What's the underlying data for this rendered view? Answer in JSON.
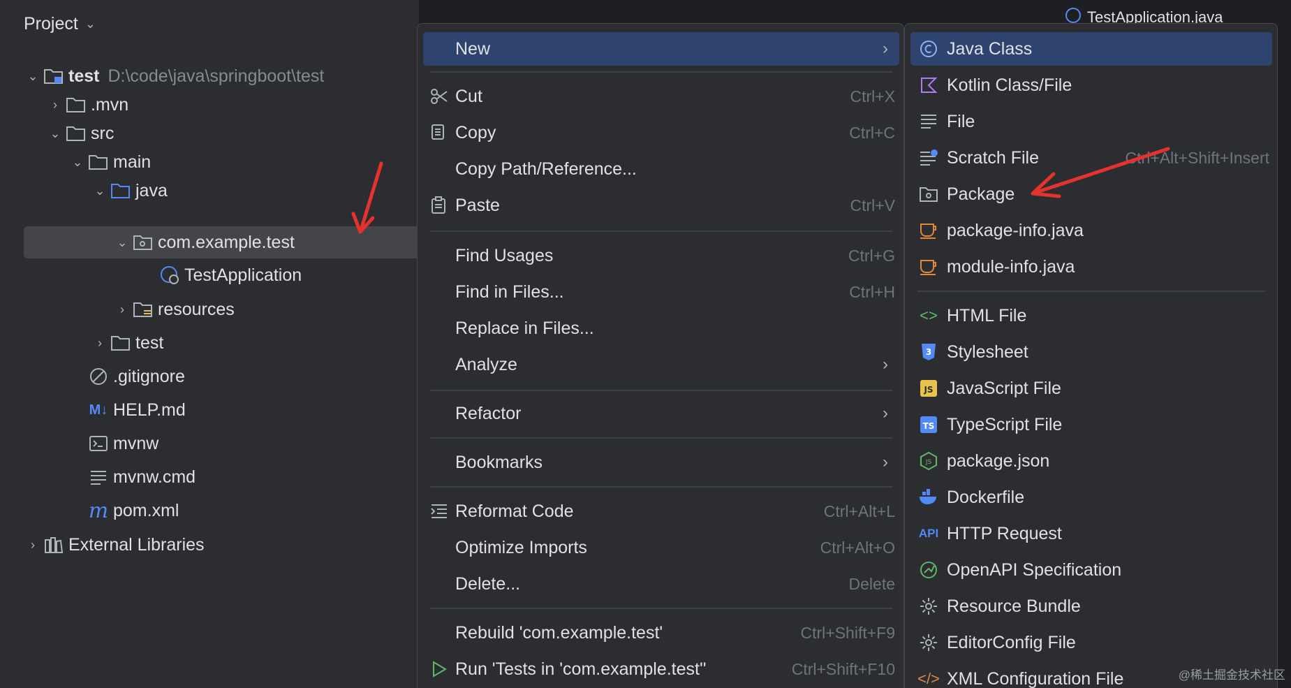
{
  "project": {
    "title": "Project",
    "tree": [
      {
        "label": "test",
        "path": "D:\\code\\java\\springboot\\test",
        "arrow": "⌄",
        "icon": "module-folder-icon"
      },
      {
        "label": ".mvn",
        "arrow": "›",
        "icon": "folder-icon"
      },
      {
        "label": "src",
        "arrow": "⌄",
        "icon": "folder-icon"
      },
      {
        "label": "main",
        "arrow": "⌄",
        "icon": "folder-icon"
      },
      {
        "label": "java",
        "arrow": "⌄",
        "icon": "source-folder-icon"
      },
      {
        "label": "com.example.test",
        "arrow": "⌄",
        "icon": "package-icon"
      },
      {
        "label": "TestApplication",
        "arrow": "",
        "icon": "spring-class-icon"
      },
      {
        "label": "resources",
        "arrow": "›",
        "icon": "resources-folder-icon"
      },
      {
        "label": "test",
        "arrow": "›",
        "icon": "folder-icon"
      },
      {
        "label": ".gitignore",
        "arrow": "",
        "icon": "ignore-icon"
      },
      {
        "label": "HELP.md",
        "arrow": "",
        "icon": "markdown-icon"
      },
      {
        "label": "mvnw",
        "arrow": "",
        "icon": "shell-icon"
      },
      {
        "label": "mvnw.cmd",
        "arrow": "",
        "icon": "text-file-icon"
      },
      {
        "label": "pom.xml",
        "arrow": "",
        "icon": "maven-icon"
      },
      {
        "label": "External Libraries",
        "arrow": "›",
        "icon": "libraries-icon"
      }
    ]
  },
  "editor": {
    "tab_label": "TestApplication.java"
  },
  "menu": {
    "items": [
      {
        "label": "New",
        "shortcut": "",
        "submenu": true
      },
      {
        "label": "Cut",
        "shortcut": "Ctrl+X",
        "icon": "scissors-icon"
      },
      {
        "label": "Copy",
        "shortcut": "Ctrl+C",
        "icon": "copy-icon"
      },
      {
        "label": "Copy Path/Reference...",
        "shortcut": ""
      },
      {
        "label": "Paste",
        "shortcut": "Ctrl+V",
        "icon": "paste-icon"
      },
      {
        "label": "Find Usages",
        "shortcut": "Ctrl+G"
      },
      {
        "label": "Find in Files...",
        "shortcut": "Ctrl+H"
      },
      {
        "label": "Replace in Files...",
        "shortcut": ""
      },
      {
        "label": "Analyze",
        "shortcut": "",
        "submenu": true
      },
      {
        "label": "Refactor",
        "shortcut": "",
        "submenu": true
      },
      {
        "label": "Bookmarks",
        "shortcut": "",
        "submenu": true
      },
      {
        "label": "Reformat Code",
        "shortcut": "Ctrl+Alt+L",
        "icon": "reformat-icon"
      },
      {
        "label": "Optimize Imports",
        "shortcut": "Ctrl+Alt+O"
      },
      {
        "label": "Delete...",
        "shortcut": "Delete"
      },
      {
        "label": "Rebuild 'com.example.test'",
        "shortcut": "Ctrl+Shift+F9"
      },
      {
        "label": "Run 'Tests in 'com.example.test''",
        "shortcut": "Ctrl+Shift+F10",
        "icon": "run-icon"
      }
    ]
  },
  "submenu": {
    "items": [
      {
        "label": "Java Class",
        "shortcut": "",
        "icon": "java-class-icon"
      },
      {
        "label": "Kotlin Class/File",
        "shortcut": "",
        "icon": "kotlin-icon"
      },
      {
        "label": "File",
        "shortcut": "",
        "icon": "file-icon"
      },
      {
        "label": "Scratch File",
        "shortcut": "Ctrl+Alt+Shift+Insert",
        "icon": "scratch-file-icon"
      },
      {
        "label": "Package",
        "shortcut": "",
        "icon": "package-icon"
      },
      {
        "label": "package-info.java",
        "shortcut": "",
        "icon": "java-file-icon"
      },
      {
        "label": "module-info.java",
        "shortcut": "",
        "icon": "java-file-icon"
      },
      {
        "label": "HTML File",
        "shortcut": "",
        "icon": "html-icon"
      },
      {
        "label": "Stylesheet",
        "shortcut": "",
        "icon": "css-icon"
      },
      {
        "label": "JavaScript File",
        "shortcut": "",
        "icon": "javascript-icon"
      },
      {
        "label": "TypeScript File",
        "shortcut": "",
        "icon": "typescript-icon"
      },
      {
        "label": "package.json",
        "shortcut": "",
        "icon": "nodejs-icon"
      },
      {
        "label": "Dockerfile",
        "shortcut": "",
        "icon": "docker-icon"
      },
      {
        "label": "HTTP Request",
        "shortcut": "",
        "icon": "api-icon"
      },
      {
        "label": "OpenAPI Specification",
        "shortcut": "",
        "icon": "openapi-icon"
      },
      {
        "label": "Resource Bundle",
        "shortcut": "",
        "icon": "gear-icon"
      },
      {
        "label": "EditorConfig File",
        "shortcut": "",
        "icon": "gear-icon"
      },
      {
        "label": "XML Configuration File",
        "shortcut": "",
        "icon": "xml-icon"
      }
    ]
  },
  "watermark": "@稀土掘金技术社区",
  "colors": {
    "accent": "#2e436e",
    "annotation": "#e5322d",
    "java": "#548af7"
  }
}
